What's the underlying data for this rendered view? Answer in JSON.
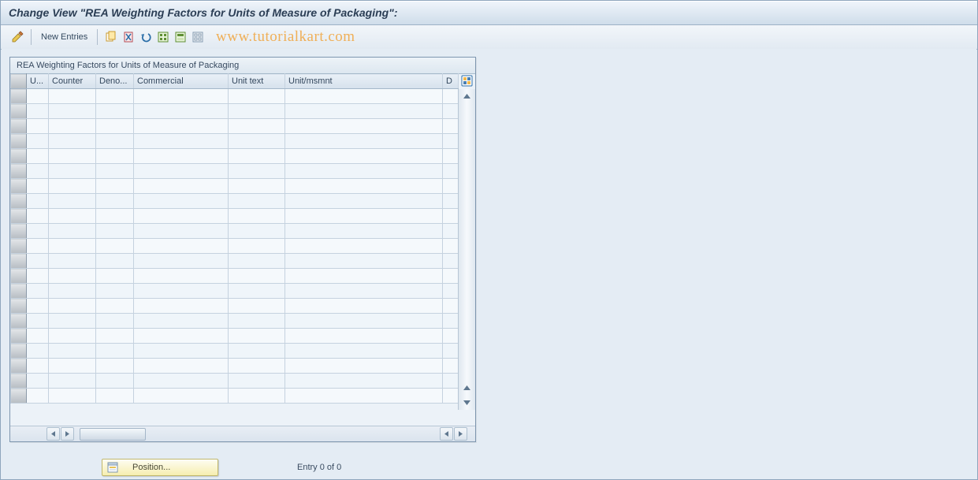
{
  "title": "Change View \"REA Weighting Factors for Units of Measure of Packaging\":",
  "toolbar": {
    "new_entries_label": "New Entries"
  },
  "watermark": "www.tutorialkart.com",
  "table": {
    "title": "REA Weighting Factors for Units of Measure of Packaging",
    "columns": {
      "u": "U...",
      "counter": "Counter",
      "deno": "Deno...",
      "commercial": "Commercial",
      "unit_text": "Unit text",
      "unit_msmnt": "Unit/msmnt",
      "d": "D"
    },
    "row_count": 21,
    "rows": []
  },
  "footer": {
    "position_label": "Position...",
    "entry_status": "Entry 0 of 0"
  },
  "icons": {
    "pencil": "change-icon",
    "copy": "copy-icon",
    "delete": "delete-icon",
    "undo": "undo-icon",
    "select_all": "select-all-icon",
    "select_block": "select-block-icon",
    "deselect_all": "deselect-all-icon",
    "table_settings": "table-settings-icon",
    "position": "position-icon"
  }
}
